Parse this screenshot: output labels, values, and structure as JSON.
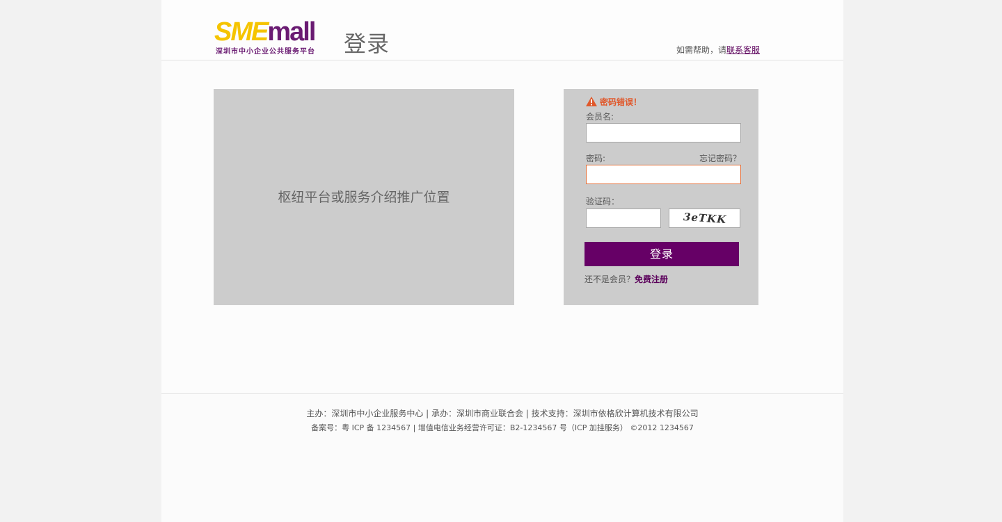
{
  "header": {
    "logo_text_a": "SME",
    "logo_text_b": "mall",
    "logo_sub": "深圳市中小企业公共服务平台",
    "title": "登录",
    "help_prefix": "如需帮助，请",
    "help_link": "联系客服"
  },
  "promo": {
    "text": "枢纽平台或服务介绍推广位置"
  },
  "login": {
    "error": "密码错误！",
    "username_label": "会员名:",
    "username_value": "",
    "password_label": "密码:",
    "password_value": "",
    "forgot_label": "忘记密码？",
    "captcha_label": "验证码：",
    "captcha_value": "",
    "captcha_image_text": "3eTKK",
    "submit_label": "登录",
    "register_prefix": "还不是会员？",
    "register_link": "免费注册"
  },
  "footer": {
    "line1": "主办：深圳市中小企业服务中心 | 承办：深圳市商业联合会 | 技术支持：深圳市依格欣计算机技术有限公司",
    "line2": "备案号：粤 ICP 备 1234567 | 增值电信业务经营许可证：B2-1234567 号（ICP 加挂服务） ©2012 1234567"
  },
  "colors": {
    "brand_purple": "#660066",
    "brand_yellow": "#f5c400",
    "error_orange": "#e0582b",
    "panel_gray": "#cccccc"
  },
  "icons": [
    "warning-icon"
  ]
}
